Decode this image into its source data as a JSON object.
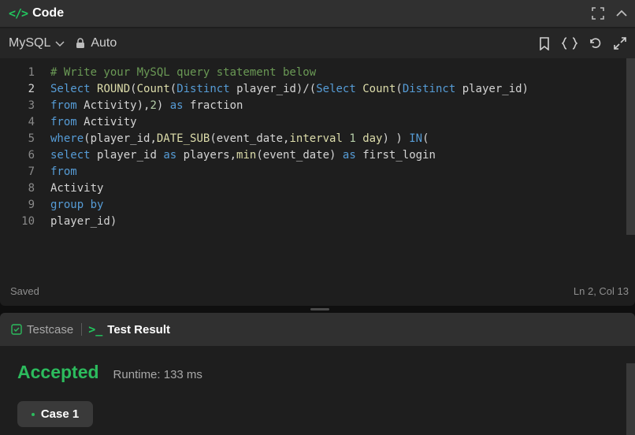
{
  "code_panel": {
    "title": "Code",
    "language": "MySQL",
    "mode": "Auto",
    "status_left": "Saved",
    "status_right": "Ln 2, Col 13"
  },
  "editor": {
    "active_line": 2,
    "line_numbers": [
      "1",
      "2",
      "3",
      "4",
      "5",
      "6",
      "7",
      "8",
      "9",
      "10"
    ],
    "lines": [
      [
        {
          "t": "cm",
          "s": "# Write your MySQL query statement below"
        }
      ],
      [
        {
          "t": "kw",
          "s": "Select "
        },
        {
          "t": "fn",
          "s": "ROUND"
        },
        {
          "t": "txt",
          "s": "("
        },
        {
          "t": "fn",
          "s": "Count"
        },
        {
          "t": "txt",
          "s": "("
        },
        {
          "t": "kw",
          "s": "Distinct"
        },
        {
          "t": "txt",
          "s": " player_id)/("
        },
        {
          "t": "kw",
          "s": "Select "
        },
        {
          "t": "fn",
          "s": "Count"
        },
        {
          "t": "txt",
          "s": "("
        },
        {
          "t": "kw",
          "s": "Distinct"
        },
        {
          "t": "txt",
          "s": " player_id)"
        }
      ],
      [
        {
          "t": "kw",
          "s": "from "
        },
        {
          "t": "txt",
          "s": "Activity),"
        },
        {
          "t": "num",
          "s": "2"
        },
        {
          "t": "txt",
          "s": ") "
        },
        {
          "t": "kw",
          "s": "as "
        },
        {
          "t": "txt",
          "s": "fraction"
        }
      ],
      [
        {
          "t": "kw",
          "s": "from "
        },
        {
          "t": "txt",
          "s": "Activity"
        }
      ],
      [
        {
          "t": "kw",
          "s": "where"
        },
        {
          "t": "txt",
          "s": "(player_id,"
        },
        {
          "t": "fn",
          "s": "DATE_SUB"
        },
        {
          "t": "txt",
          "s": "(event_date,"
        },
        {
          "t": "fn",
          "s": "interval "
        },
        {
          "t": "num",
          "s": "1 "
        },
        {
          "t": "fn",
          "s": "day"
        },
        {
          "t": "txt",
          "s": ") ) "
        },
        {
          "t": "kw",
          "s": "IN"
        },
        {
          "t": "txt",
          "s": "("
        }
      ],
      [
        {
          "t": "kw",
          "s": "select "
        },
        {
          "t": "txt",
          "s": "player_id "
        },
        {
          "t": "kw",
          "s": "as "
        },
        {
          "t": "txt",
          "s": "players,"
        },
        {
          "t": "fn",
          "s": "min"
        },
        {
          "t": "txt",
          "s": "(event_date) "
        },
        {
          "t": "kw",
          "s": "as "
        },
        {
          "t": "txt",
          "s": "first_login"
        }
      ],
      [
        {
          "t": "kw",
          "s": "from"
        }
      ],
      [
        {
          "t": "txt",
          "s": "Activity"
        }
      ],
      [
        {
          "t": "kw",
          "s": "group by"
        }
      ],
      [
        {
          "t": "txt",
          "s": "player_id)"
        }
      ]
    ]
  },
  "result_panel": {
    "tabs": [
      {
        "label": "Testcase",
        "active": false
      },
      {
        "label": "Test Result",
        "active": true
      }
    ],
    "verdict": "Accepted",
    "runtime": "Runtime: 133 ms",
    "cases": [
      "Case 1"
    ]
  },
  "colors": {
    "accent_green": "#2cbb5d",
    "keyword": "#569cd6",
    "function": "#dcdcaa",
    "number": "#b5cea8",
    "comment": "#6a9955"
  },
  "icons": {
    "header": [
      "code-icon",
      "fullscreen-icon",
      "chevron-up-icon"
    ],
    "toolbar": [
      "bookmark-icon",
      "braces-icon",
      "reset-icon",
      "expand-icon"
    ],
    "tabs": [
      "checkbox-icon",
      "terminal-icon"
    ]
  }
}
